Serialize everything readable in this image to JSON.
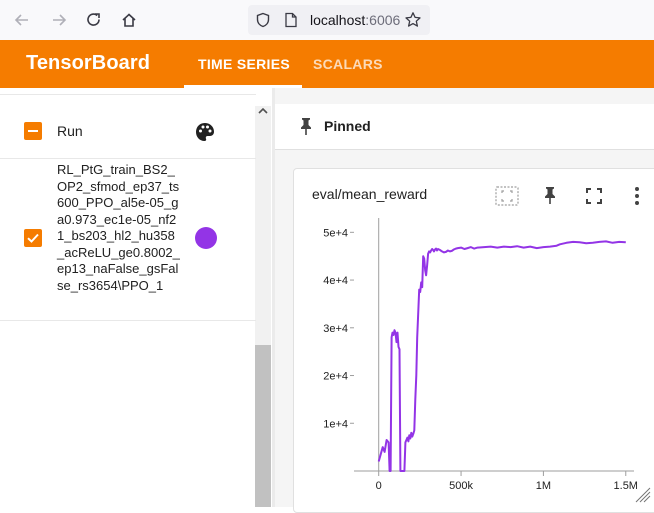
{
  "browser": {
    "url_host": "localhost",
    "url_port": ":6006"
  },
  "app": {
    "title": "TensorBoard",
    "tabs": [
      {
        "label": "TIME SERIES",
        "active": true
      },
      {
        "label": "SCALARS",
        "active": false
      }
    ],
    "accent_color": "#f57c00"
  },
  "sidebar": {
    "header_label": "Run",
    "runs": [
      {
        "name": "RL_PtG_train_BS2_OP2_sfmod_ep37_ts600_PPO_al5e-05_ga0.973_ec1e-05_nf21_bs203_hl2_hu358_acReLU_ge0.8002_ep13_naFalse_gsFalse_rs3654\\PPO_1",
        "checked": true,
        "color": "#9334e6"
      }
    ]
  },
  "main": {
    "pinned_label": "Pinned",
    "card_title": "eval/mean_reward"
  },
  "chart_data": {
    "type": "line",
    "title": "eval/mean_reward",
    "xlim": [
      -150000,
      1550000
    ],
    "ylim": [
      0,
      53000
    ],
    "x_ticks": [
      0,
      500000,
      1000000,
      1500000
    ],
    "x_tick_labels": [
      "0",
      "500k",
      "1M",
      "1.5M"
    ],
    "y_ticks": [
      10000,
      20000,
      30000,
      40000,
      50000
    ],
    "y_tick_labels": [
      "1e+4",
      "2e+4",
      "3e+4",
      "4e+4",
      "5e+4"
    ],
    "grid": false,
    "series": [
      {
        "color": "#9334e6",
        "x": [
          0,
          12000,
          24000,
          36000,
          48000,
          60000,
          66000,
          72000,
          78000,
          84000,
          90000,
          96000,
          102000,
          108000,
          114000,
          120000,
          126000,
          132000,
          138000,
          144000,
          150000,
          156000,
          162000,
          168000,
          174000,
          180000,
          186000,
          192000,
          198000,
          204000,
          210000,
          216000,
          222000,
          228000,
          234000,
          240000,
          246000,
          252000,
          258000,
          264000,
          270000,
          276000,
          282000,
          288000,
          294000,
          300000,
          306000,
          312000,
          318000,
          324000,
          330000,
          336000,
          342000,
          348000,
          354000,
          360000,
          372000,
          384000,
          396000,
          408000,
          420000,
          432000,
          444000,
          456000,
          468000,
          480000,
          500000,
          520000,
          540000,
          560000,
          580000,
          600000,
          640000,
          680000,
          720000,
          760000,
          800000,
          840000,
          880000,
          920000,
          960000,
          1000000,
          1040000,
          1080000,
          1100000,
          1140000,
          1180000,
          1220000,
          1260000,
          1300000,
          1340000,
          1380000,
          1420000,
          1460000,
          1500000
        ],
        "y": [
          2000,
          3500,
          5000,
          4000,
          6500,
          6000,
          0,
          0,
          28000,
          29000,
          28500,
          29500,
          29000,
          27000,
          29000,
          26000,
          25500,
          0,
          0,
          0,
          0,
          0,
          6000,
          6500,
          7000,
          6200,
          7500,
          6800,
          8000,
          7200,
          7800,
          8500,
          15000,
          20000,
          28000,
          33000,
          38000,
          37500,
          39500,
          38500,
          45000,
          44500,
          42000,
          41000,
          43000,
          45500,
          46000,
          45800,
          46200,
          46500,
          46300,
          46000,
          46400,
          46600,
          46200,
          46500,
          46300,
          46000,
          45800,
          45900,
          46200,
          46000,
          46100,
          46400,
          46600,
          46700,
          46800,
          46500,
          46700,
          46900,
          46600,
          46800,
          46900,
          47000,
          46800,
          47000,
          46900,
          47100,
          46800,
          47000,
          46700,
          46900,
          47000,
          47200,
          47500,
          47800,
          48000,
          47900,
          47700,
          47800,
          48000,
          48100,
          47800,
          48000,
          47900
        ]
      }
    ]
  }
}
